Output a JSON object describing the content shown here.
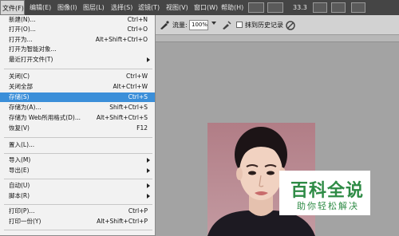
{
  "menubar": {
    "items": [
      "文件(F)",
      "编辑(E)",
      "图像(I)",
      "图层(L)",
      "选择(S)",
      "滤镜(T)",
      "视图(V)",
      "窗口(W)",
      "帮助(H)"
    ],
    "zoom": "33.3"
  },
  "options": {
    "flow_label": "流量:",
    "flow_value": "100%",
    "history_label": "抹到历史记录"
  },
  "file_menu": {
    "items": [
      {
        "label": "新建(N)...",
        "shortcut": "Ctrl+N"
      },
      {
        "label": "打开(O)...",
        "shortcut": "Ctrl+O"
      },
      {
        "label": "打开为...",
        "shortcut": "Alt+Shift+Ctrl+O"
      },
      {
        "label": "打开为智能对象...",
        "shortcut": ""
      },
      {
        "label": "最近打开文件(T)",
        "shortcut": ""
      },
      {
        "label": "关闭(C)",
        "shortcut": "Ctrl+W"
      },
      {
        "label": "关闭全部",
        "shortcut": "Alt+Ctrl+W"
      },
      {
        "label": "存储(S)",
        "shortcut": "Ctrl+S"
      },
      {
        "label": "存储为(A)...",
        "shortcut": "Shift+Ctrl+S"
      },
      {
        "label": "存储为 Web所用格式(D)...",
        "shortcut": "Alt+Shift+Ctrl+S"
      },
      {
        "label": "恢复(V)",
        "shortcut": "F12"
      },
      {
        "label": "置入(L)...",
        "shortcut": ""
      },
      {
        "label": "导入(M)",
        "shortcut": ""
      },
      {
        "label": "导出(E)",
        "shortcut": ""
      },
      {
        "label": "自动(U)",
        "shortcut": ""
      },
      {
        "label": "脚本(R)",
        "shortcut": ""
      },
      {
        "label": "打印(P)...",
        "shortcut": "Ctrl+P"
      },
      {
        "label": "打印一份(Y)",
        "shortcut": "Alt+Shift+Ctrl+P"
      }
    ]
  },
  "watermark": {
    "title": "百科全说",
    "subtitle": "助你轻松解决"
  }
}
